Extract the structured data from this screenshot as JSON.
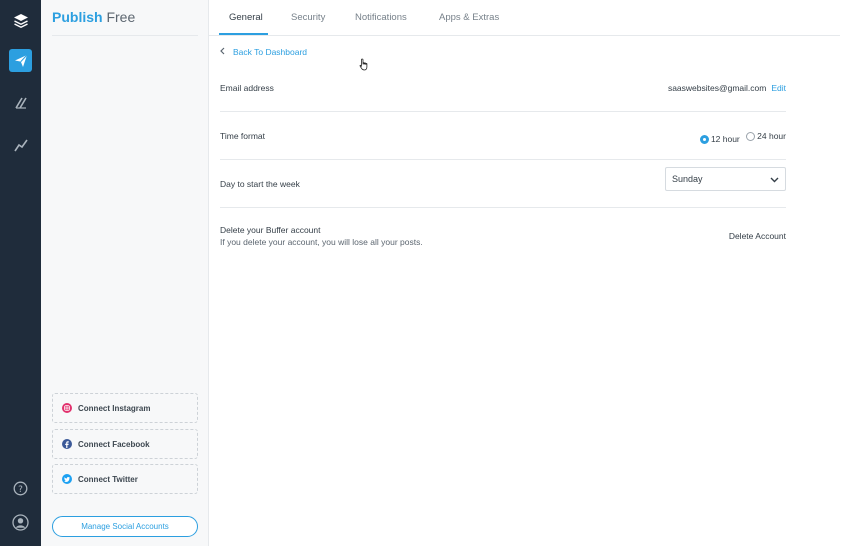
{
  "brand": {
    "name_bold": "Publish",
    "name_plan": "Free"
  },
  "rail": {
    "icons": [
      "layers-icon",
      "send-icon",
      "reply-icon",
      "analyze-icon",
      "help-icon",
      "user-icon"
    ]
  },
  "sidebar": {
    "connect": [
      {
        "label": "Connect Instagram",
        "icon": "instagram-icon",
        "color": "#e1306c"
      },
      {
        "label": "Connect Facebook",
        "icon": "facebook-icon",
        "color": "#3b5998"
      },
      {
        "label": "Connect Twitter",
        "icon": "twitter-icon",
        "color": "#1da1f2"
      }
    ],
    "manage_label": "Manage Social Accounts"
  },
  "tabs": [
    {
      "label": "General",
      "active": true
    },
    {
      "label": "Security",
      "active": false
    },
    {
      "label": "Notifications",
      "active": false
    },
    {
      "label": "Apps & Extras",
      "active": false
    }
  ],
  "back_label": "Back To Dashboard",
  "settings": {
    "email": {
      "label": "Email address",
      "value": "saaswebsites@gmail.com",
      "edit_label": "Edit"
    },
    "time_format": {
      "label": "Time format",
      "options": [
        "12 hour",
        "24 hour"
      ],
      "selected": "12 hour"
    },
    "week_start": {
      "label": "Day to start the week",
      "value": "Sunday"
    },
    "delete": {
      "label": "Delete your Buffer account",
      "description": "If you delete your account, you will lose all your posts.",
      "action_label": "Delete Account"
    }
  },
  "colors": {
    "accent": "#2c9fe0",
    "rail_bg": "#1f2c3b"
  }
}
